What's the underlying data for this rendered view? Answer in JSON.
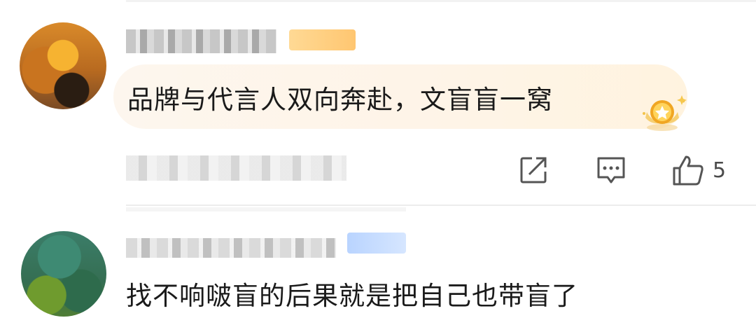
{
  "comments": [
    {
      "text": "品牌与代言人双向奔赴，文盲盲一窝",
      "likes": "5",
      "avatar_icon": "avatar-orange-pixelated",
      "badge_color": "#ffc15e",
      "bubble_color": "#fef4e7"
    },
    {
      "text": "找不响啵盲的后果就是把自己也带盲了",
      "avatar_icon": "avatar-green-pixelated",
      "badge_color": "#c5dcff"
    }
  ],
  "icons": {
    "share": "share-icon",
    "reply": "reply-icon",
    "like": "like-icon",
    "medal": "medal-icon"
  }
}
